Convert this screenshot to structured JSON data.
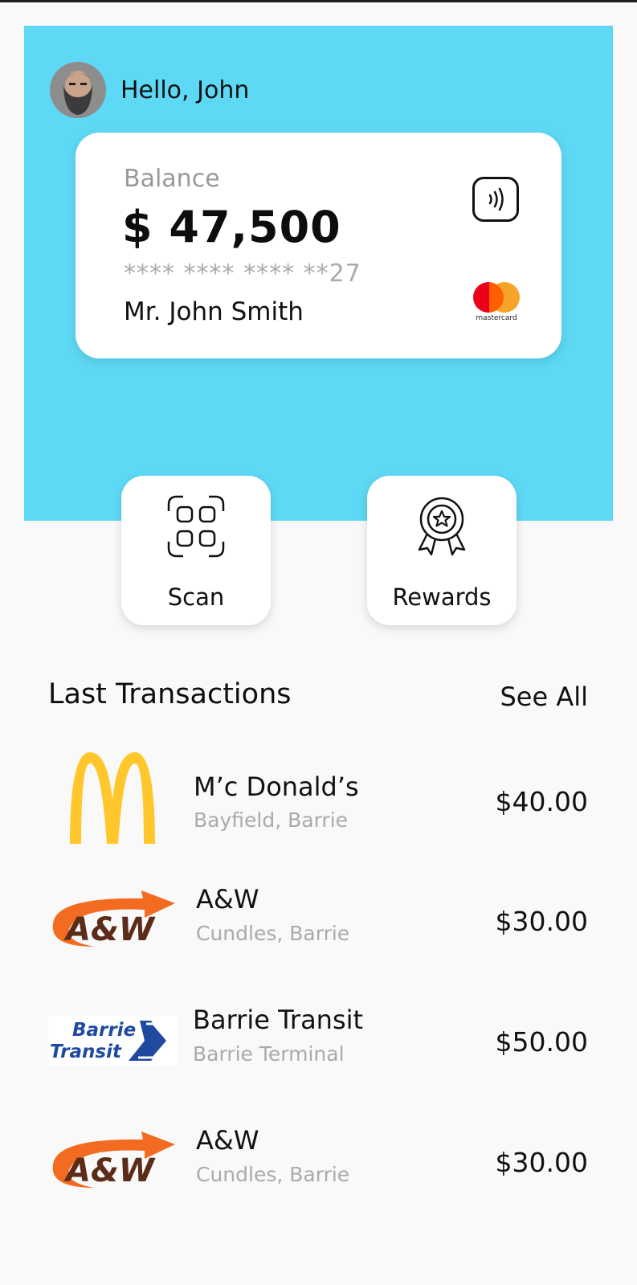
{
  "header": {
    "greeting": "Hello, John"
  },
  "card": {
    "balance_label": "Balance",
    "balance_value": "$ 47,500",
    "card_number": "**** **** **** **27",
    "holder": "Mr. John Smith",
    "brand": "mastercard"
  },
  "actions": [
    {
      "label": "Scan",
      "icon": "scan-icon"
    },
    {
      "label": "Rewards",
      "icon": "award-icon"
    }
  ],
  "transactions_section": {
    "title": "Last Transactions",
    "see_all": "See All"
  },
  "transactions": [
    {
      "name": "M’c Donald’s",
      "location": "Bayfield, Barrie",
      "amount": "$40.00",
      "logo": "mcdonalds-logo"
    },
    {
      "name": "A&W",
      "location": "Cundles, Barrie",
      "amount": "$30.00",
      "logo": "aw-logo",
      "logo_text": "A&W"
    },
    {
      "name": "Barrie Transit",
      "location": "Barrie Terminal",
      "amount": "$50.00",
      "logo": "barrie-transit-logo",
      "logo_text": "Barrie Transit"
    },
    {
      "name": "A&W",
      "location": "Cundles, Barrie",
      "amount": "$30.00",
      "logo": "aw-logo",
      "logo_text": "A&W"
    }
  ],
  "colors": {
    "hero": "#5ed9f5",
    "mastercard_red": "#eb001b",
    "mastercard_orange": "#f79e1b",
    "mcdonalds_yellow": "#ffc72c",
    "aw_orange": "#f26b21",
    "aw_brown": "#5b2c1a",
    "transit_blue": "#1f4aa0"
  }
}
